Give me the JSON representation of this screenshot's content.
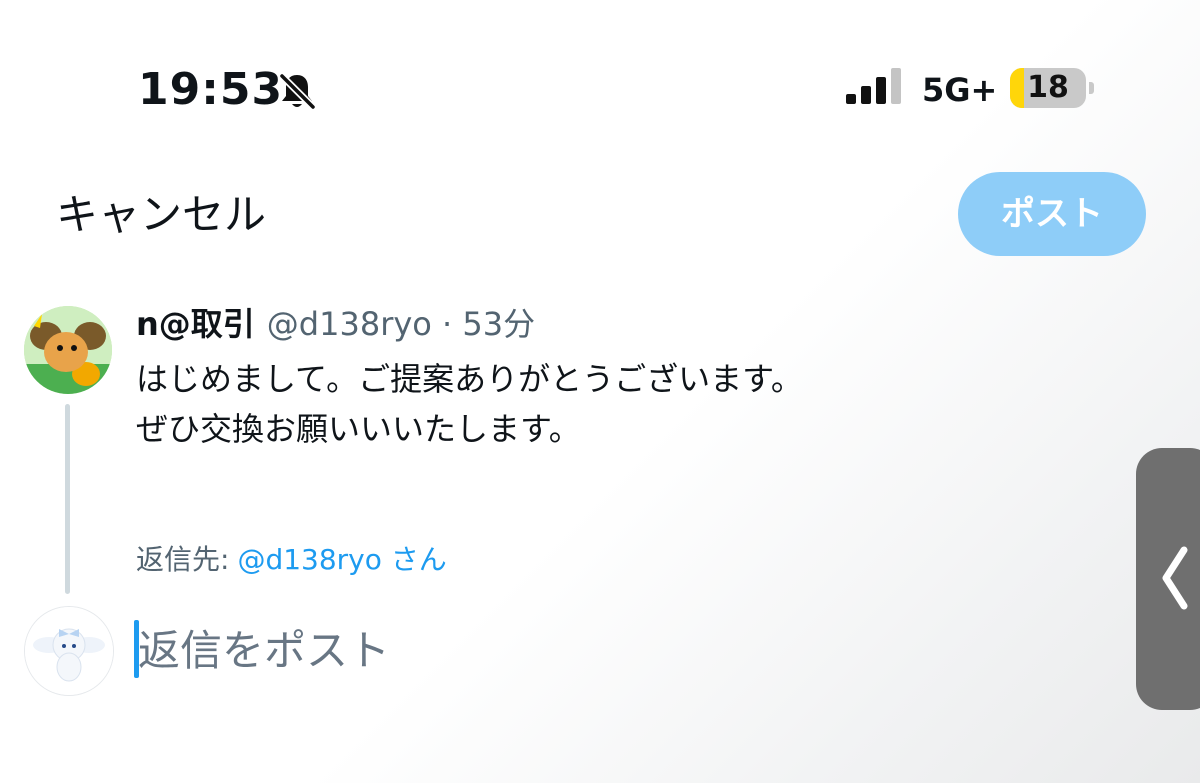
{
  "status_bar": {
    "time": "19:53",
    "bell_icon": "bell-slash-icon",
    "signal_icon": "cellular-signal-icon",
    "network": "5G+",
    "battery_level": "18"
  },
  "header": {
    "cancel_label": "キャンセル",
    "post_label": "ポスト",
    "post_button_color": "#8ecdf8"
  },
  "tweet": {
    "display_name": "n@取引",
    "meta": "@d138ryo · 53分",
    "body_lines": [
      "はじめまして。ご提案ありがとうございます。",
      "ぜひ交換お願いいいたします。"
    ]
  },
  "reply_to": {
    "label": "返信先:",
    "handle": "@d138ryo さん"
  },
  "compose": {
    "placeholder": "返信をポスト",
    "value": ""
  },
  "side_handle": {
    "icon": "chevron-left-icon"
  },
  "colors": {
    "accent": "#1d9bf0",
    "secondary_text": "#536471"
  }
}
